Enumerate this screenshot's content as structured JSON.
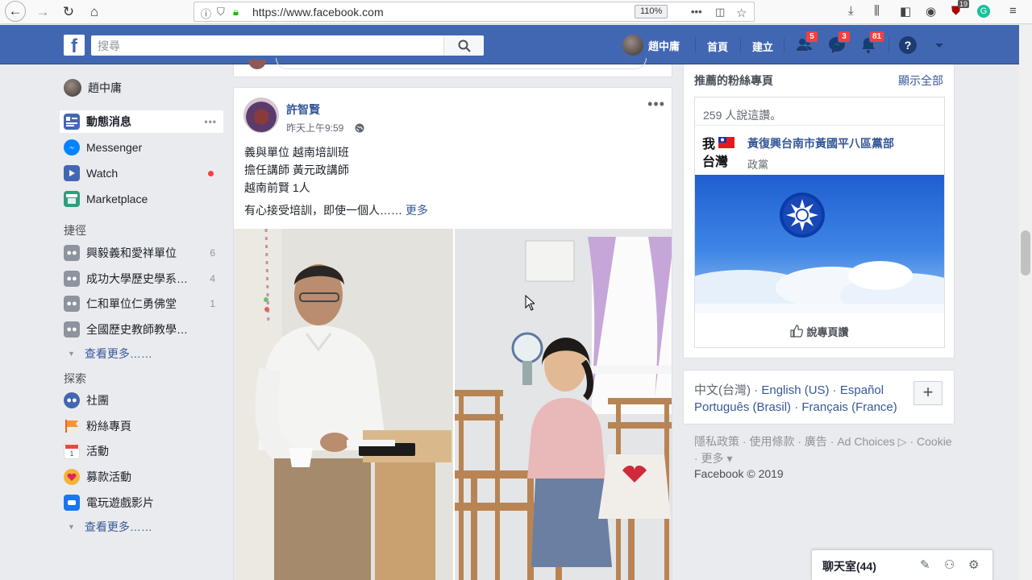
{
  "browser": {
    "url": "https://www.facebook.com",
    "zoom": "110%",
    "download_badge": "19"
  },
  "topbar": {
    "search_placeholder": "搜尋",
    "user_name": "趙中庸",
    "home": "首頁",
    "create": "建立",
    "friend_requests_badge": "5",
    "messages_badge": "3",
    "notifications_badge": "81"
  },
  "left_nav": {
    "profile_name": "趙中庸",
    "news_feed": "動態消息",
    "news_feed_more": "•••",
    "messenger": "Messenger",
    "watch": "Watch",
    "marketplace": "Marketplace",
    "shortcuts_header": "捷徑",
    "shortcuts": [
      {
        "label": "興毅義和愛祥單位",
        "count": "6"
      },
      {
        "label": "成功大學歷史學系…",
        "count": "4"
      },
      {
        "label": "仁和單位仁勇佛堂",
        "count": "1"
      },
      {
        "label": "全國歷史教師教學…",
        "count": ""
      }
    ],
    "see_more": "查看更多……",
    "explore_header": "探索",
    "explore": [
      {
        "label": "社團"
      },
      {
        "label": "粉絲專頁"
      },
      {
        "label": "活動"
      },
      {
        "label": "募款活動"
      },
      {
        "label": "電玩遊戲影片"
      }
    ],
    "explore_see_more": "查看更多……"
  },
  "post": {
    "author": "許智賢",
    "time": "昨天上午9:59",
    "menu": "•••",
    "lines": [
      "義與單位 越南培訓班",
      "擔任講師 黃元政講師",
      "越南前賢 1人"
    ],
    "last_line": "有心接受培訓，即使一個人……",
    "more": "更多"
  },
  "suggested": {
    "title": "推薦的粉絲專頁",
    "see_all": "顯示全部",
    "likes": "259 人說這讚。",
    "logo_text_1": "我",
    "logo_text_2": "台灣",
    "page_name": "黃復興台南市黃國平八區黨部",
    "page_category": "政黨",
    "like_page": "說專頁讚"
  },
  "languages": {
    "current": "中文(台灣)",
    "sep": " · ",
    "options": [
      "English (US)",
      "Español",
      "Português (Brasil)",
      "Français (France)"
    ],
    "plus": "+"
  },
  "footer": {
    "links": "隱私政策 · 使用條款 · 廣告 · Ad Choices ▷ · Cookie · 更多 ▾",
    "copyright": "Facebook © 2019"
  },
  "chat": {
    "label": "聊天室(44)"
  },
  "colors": {
    "fb_blue": "#4267b2",
    "link_blue": "#365899",
    "badge_red": "#fa3e3e"
  }
}
